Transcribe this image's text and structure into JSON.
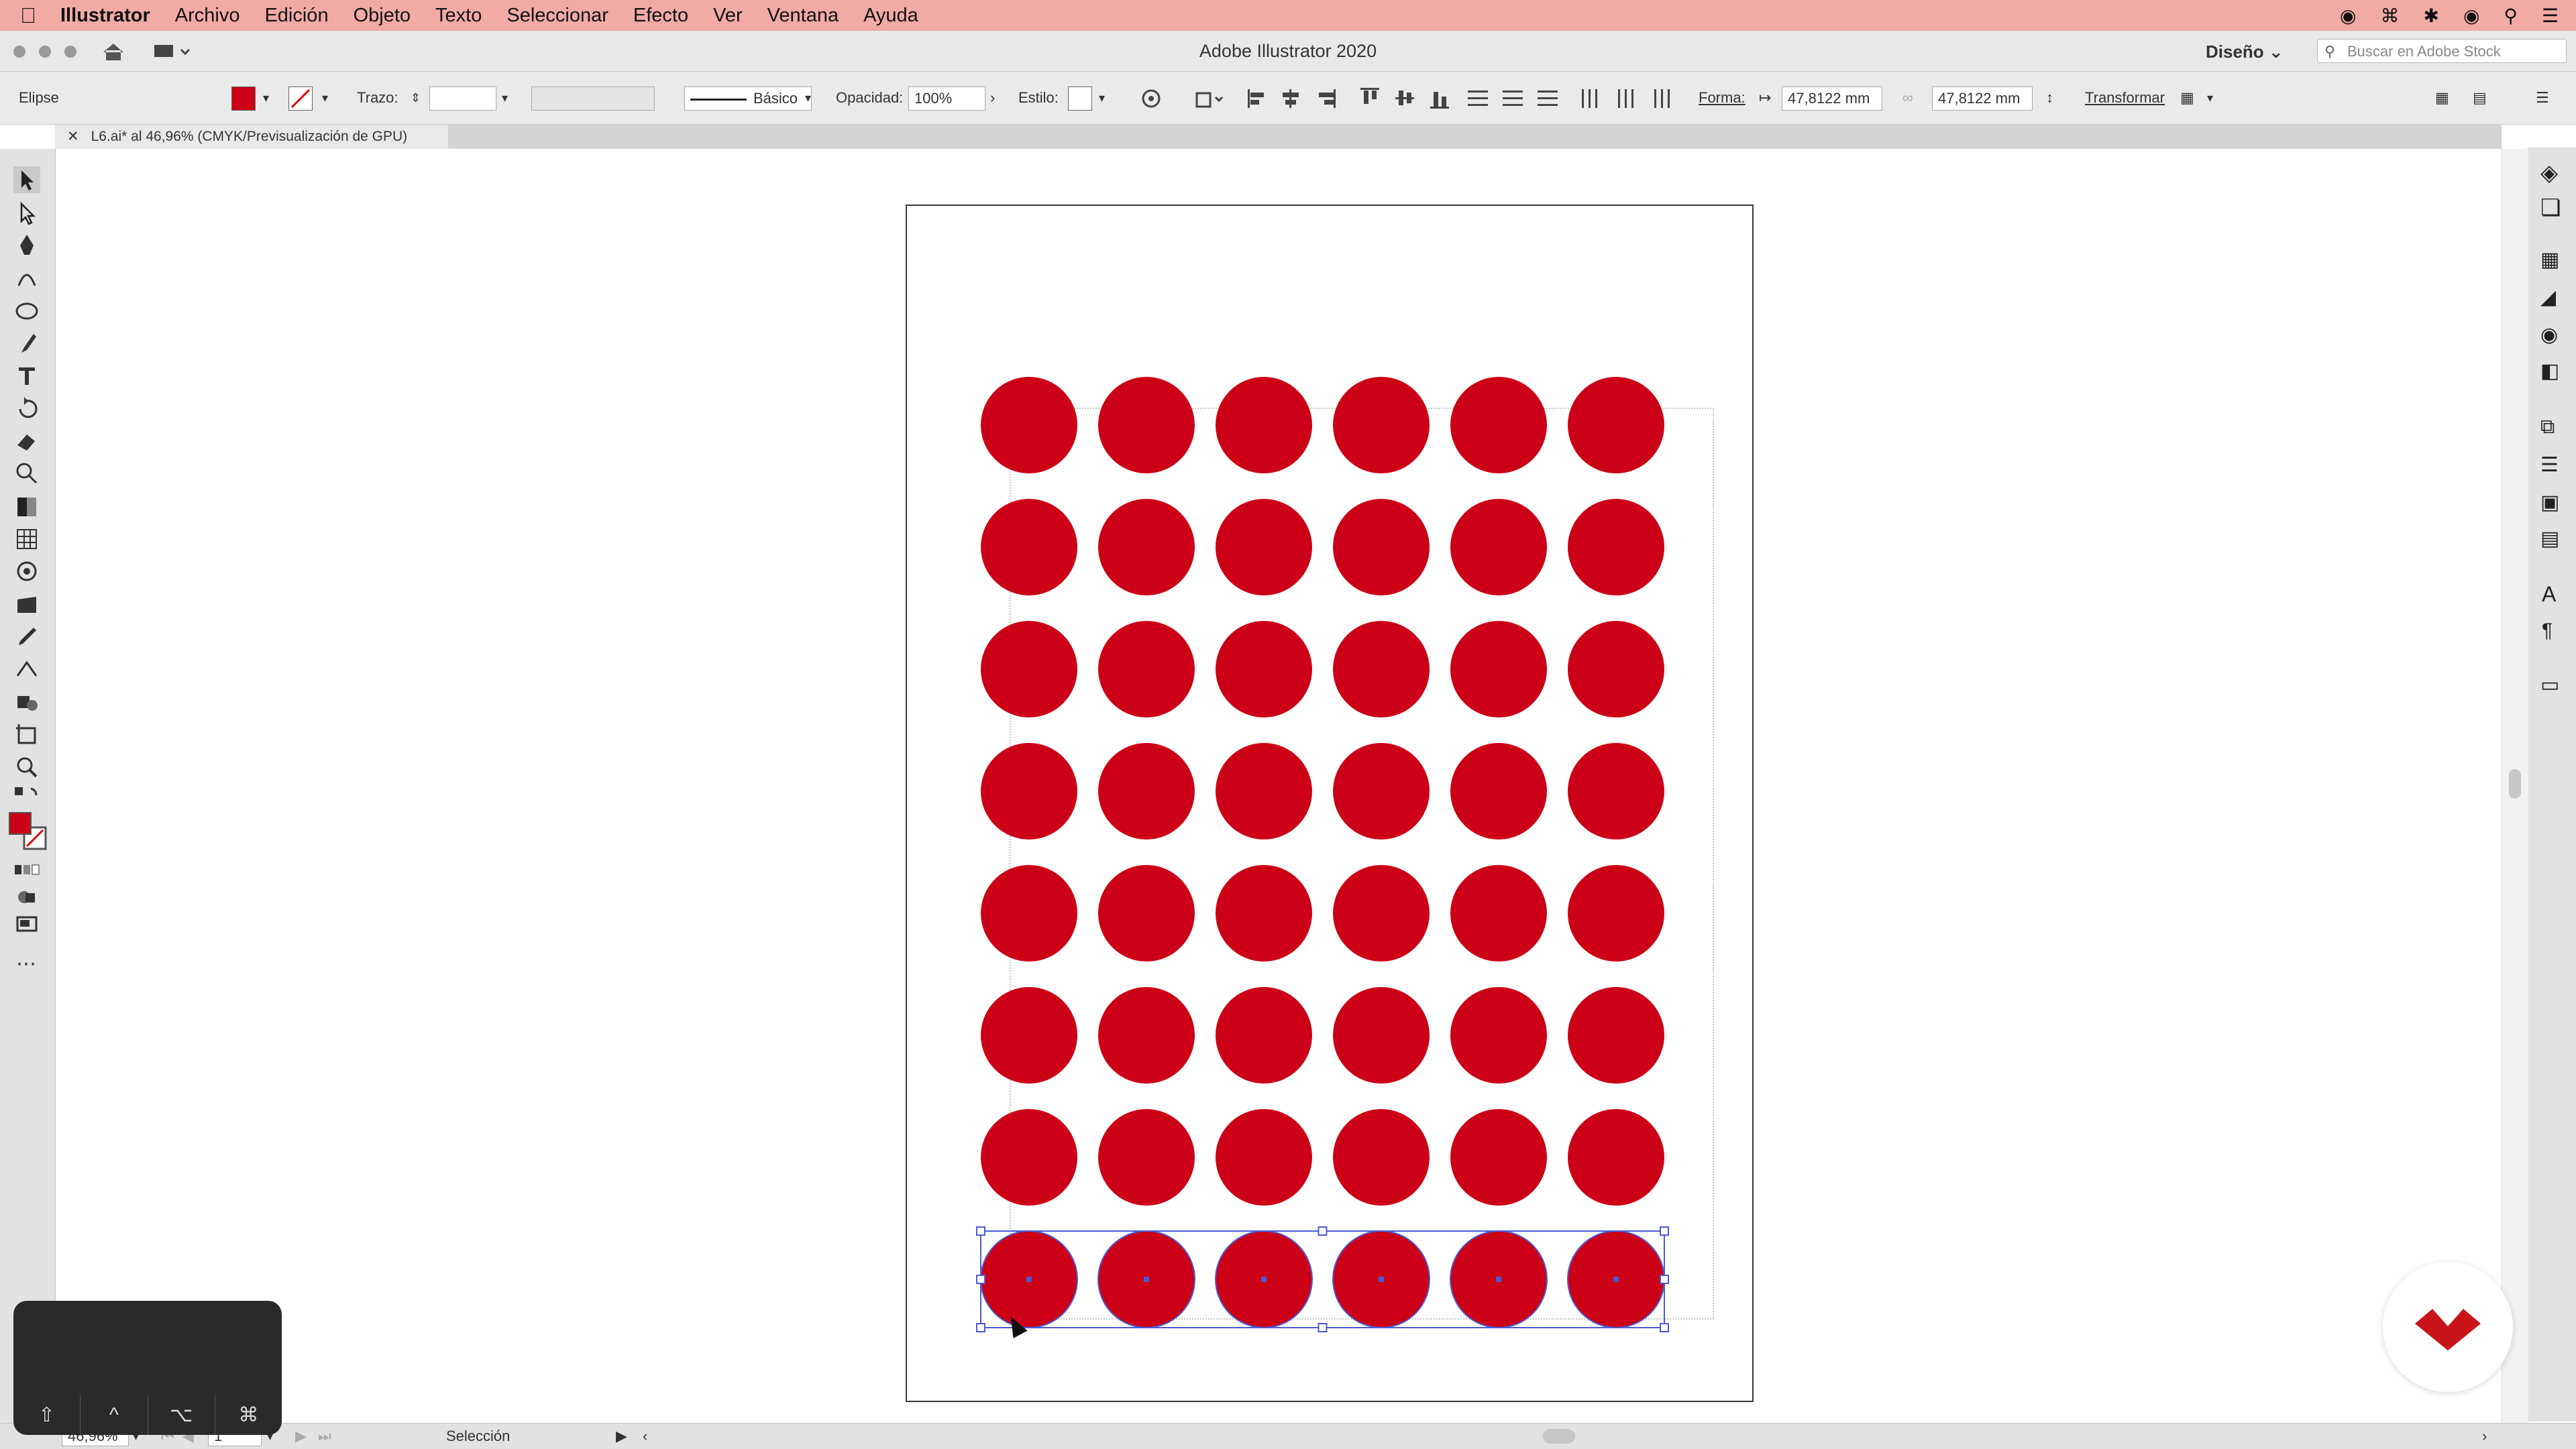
{
  "menubar": {
    "items": [
      "Illustrator",
      "Archivo",
      "Edición",
      "Objeto",
      "Texto",
      "Seleccionar",
      "Efecto",
      "Ver",
      "Ventana",
      "Ayuda"
    ]
  },
  "window": {
    "title": "Adobe Illustrator 2020",
    "workspace": "Diseño",
    "stock_placeholder": "Buscar en Adobe Stock"
  },
  "control": {
    "object_type": "Elipse",
    "fill_color": "#cc0016",
    "stroke_label": "Trazo:",
    "brush": "Básico",
    "opacity_label": "Opacidad:",
    "opacity_value": "100%",
    "style_label": "Estilo:",
    "shape_label": "Forma:",
    "width": "47,8122 mm",
    "height": "47,8122 mm",
    "transform_label": "Transformar"
  },
  "doc": {
    "tab": "L6.ai* al 46,96% (CMYK/Previsualización de GPU)"
  },
  "status": {
    "zoom": "46,96%",
    "artboard": "1",
    "tool": "Selección"
  },
  "keys": [
    "⇧",
    "^",
    "⌥",
    "⌘"
  ],
  "dots": {
    "color": "#cc0016",
    "columns": 6,
    "rows": 8,
    "selected_row": 8,
    "selection_color": "#4a5bd6"
  }
}
